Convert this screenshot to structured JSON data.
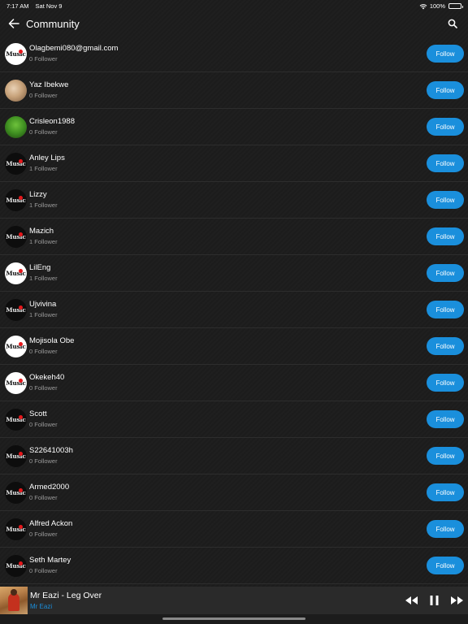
{
  "status_bar": {
    "time": "7:17 AM",
    "date": "Sat Nov 9",
    "battery": "100%"
  },
  "header": {
    "title": "Community",
    "back_icon": "back-arrow-icon",
    "search_icon": "search-icon"
  },
  "users": [
    {
      "name": "Olagbemi080@gmail.com",
      "followers": "0 Follower",
      "avatar": "music-light",
      "follow_label": "Follow"
    },
    {
      "name": "Yaz Ibekwe",
      "followers": "0 Follower",
      "avatar": "photo-yaz",
      "follow_label": "Follow"
    },
    {
      "name": "Crisleon1988",
      "followers": "0 Follower",
      "avatar": "photo-cris",
      "follow_label": "Follow"
    },
    {
      "name": "Anley Lips",
      "followers": "1 Follower",
      "avatar": "music-dark",
      "follow_label": "Follow"
    },
    {
      "name": "Lizzy",
      "followers": "1 Follower",
      "avatar": "music-dark",
      "follow_label": "Follow"
    },
    {
      "name": "Mazich",
      "followers": "1 Follower",
      "avatar": "music-dark",
      "follow_label": "Follow"
    },
    {
      "name": "LilEng",
      "followers": "1 Follower",
      "avatar": "music-light",
      "follow_label": "Follow"
    },
    {
      "name": "Ujvivina",
      "followers": "1 Follower",
      "avatar": "music-dark",
      "follow_label": "Follow"
    },
    {
      "name": "Mojisola Obe",
      "followers": "0 Follower",
      "avatar": "music-light",
      "follow_label": "Follow"
    },
    {
      "name": "Okekeh40",
      "followers": "0 Follower",
      "avatar": "music-light",
      "follow_label": "Follow"
    },
    {
      "name": "Scott",
      "followers": "0 Follower",
      "avatar": "music-dark",
      "follow_label": "Follow"
    },
    {
      "name": "S22641003h",
      "followers": "0 Follower",
      "avatar": "music-dark",
      "follow_label": "Follow"
    },
    {
      "name": "Armed2000",
      "followers": "0 Follower",
      "avatar": "music-dark",
      "follow_label": "Follow"
    },
    {
      "name": "Alfred Ackon",
      "followers": "0 Follower",
      "avatar": "music-dark",
      "follow_label": "Follow"
    },
    {
      "name": "Seth Martey",
      "followers": "0 Follower",
      "avatar": "music-dark",
      "follow_label": "Follow"
    }
  ],
  "avatar_logo_text": "Music",
  "now_playing": {
    "title": "Mr Eazi - Leg Over",
    "artist": "Mr Eazi",
    "controls": [
      "rewind-icon",
      "pause-icon",
      "fast-forward-icon"
    ]
  },
  "colors": {
    "accent": "#1a8fdc",
    "background": "#1e1e1e",
    "player_bg": "#2a2a2a",
    "logo_dot": "#e5171b"
  }
}
